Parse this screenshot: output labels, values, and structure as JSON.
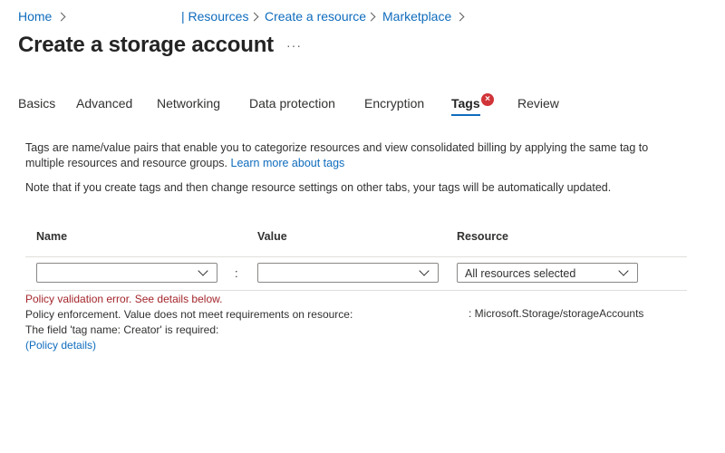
{
  "breadcrumb": {
    "home": "Home",
    "resources": "| Resources",
    "create_resource": "Create a resource",
    "marketplace": "Marketplace"
  },
  "page": {
    "title": "Create a storage account",
    "more": "···"
  },
  "tabs": [
    {
      "label": "Basics"
    },
    {
      "label": "Advanced"
    },
    {
      "label": "Networking"
    },
    {
      "label": "Data protection"
    },
    {
      "label": "Encryption"
    },
    {
      "label": "Tags",
      "active": true,
      "has_error": true
    },
    {
      "label": "Review"
    }
  ],
  "error_badge": "×",
  "description": {
    "line1": "Tags are name/value pairs that enable you to categorize resources and view consolidated billing by applying the same tag to multiple resources and resource groups.",
    "learn_more": "Learn more about tags",
    "note": "Note that if you create tags and then change resource settings on other tabs, your tags will be automatically updated."
  },
  "table": {
    "headers": {
      "name": "Name",
      "value": "Value",
      "resource": "Resource"
    },
    "row": {
      "name": "",
      "separator": ":",
      "value": "",
      "resource": "All resources selected"
    }
  },
  "errors": {
    "validation": "Policy validation error. See details below.",
    "enforcement": "Policy enforcement. Value does not meet requirements on resource:",
    "resource": ": Microsoft.Storage/storageAccounts",
    "field": "The field 'tag name: Creator' is required:",
    "details_link": "(Policy details)"
  },
  "colors": {
    "link": "#0f6cbd",
    "error": "#a4262c",
    "badge": "#d13438"
  }
}
